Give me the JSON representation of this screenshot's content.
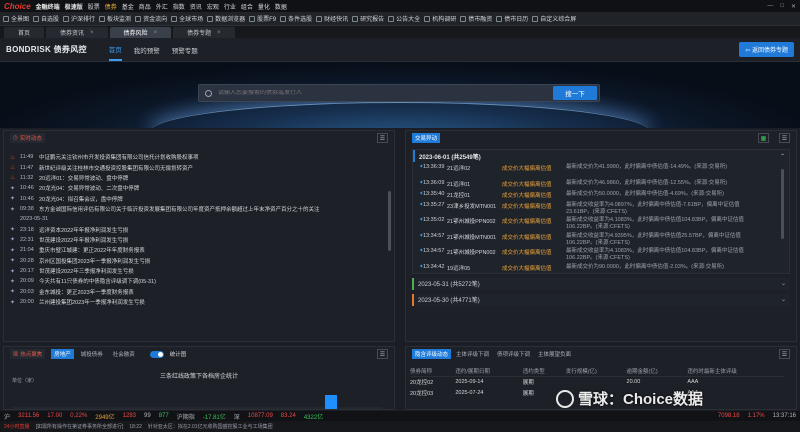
{
  "titlebar": {
    "brand": "Choice",
    "product": "金融终端",
    "terminal": "极速版",
    "menus": [
      "股票",
      "债券",
      "基金",
      "商品",
      "外汇",
      "指数",
      "资讯",
      "宏观",
      "行业",
      "组合",
      "量化",
      "数据"
    ],
    "hot_index": 1
  },
  "toolbar": [
    "全景图",
    "自选股",
    "沪深排行",
    "板块监测",
    "资金流向",
    "全球市场",
    "数据浏览器",
    "股票F9",
    "条件选股",
    "财经快讯",
    "研究报告",
    "公告大全",
    "机构调研",
    "债市融资",
    "债市日历",
    "自定义综合屏"
  ],
  "window_tabs": [
    {
      "label": "首页",
      "active": false
    },
    {
      "label": "债券资讯",
      "active": false
    },
    {
      "label": "债券风险",
      "active": true
    },
    {
      "label": "债券专题",
      "active": false
    }
  ],
  "app": {
    "brand": "BONDRISK 债券风控",
    "nav": [
      {
        "label": "首页",
        "active": true
      },
      {
        "label": "我的预警",
        "active": false
      },
      {
        "label": "预警专题",
        "active": false
      }
    ],
    "back_label": "返回债券专题"
  },
  "search": {
    "placeholder": "请输入您要搜索的债券或发行人",
    "button": "搜一下"
  },
  "realtime": {
    "title": "实时动态",
    "items_top": [
      {
        "time": "11:49",
        "hot": true,
        "text": "中证鹏元关注钦州市开发投资集团有限公司信托计划收购股权事项"
      },
      {
        "time": "11:47",
        "hot": true,
        "text": "新世纪评级关注桂林市交通投资控股集团有限公司无偿划转资产"
      },
      {
        "time": "11:32",
        "hot": true,
        "text": "20远洋01：交易异常波动、盘中停牌"
      },
      {
        "time": "10:46",
        "hot": false,
        "text": "20龙光04：交易异常波动、二次盘中停牌"
      },
      {
        "time": "10:46",
        "hot": false,
        "text": "20龙光04：拟召集会议，盘中停牌"
      },
      {
        "time": "09:38",
        "hot": false,
        "text": "东方金诚国际信用评估有限公司关于临沂投资发展集团有限公司年度资产抵押余额超过上年末净资产百分之十的关注"
      }
    ],
    "date_sep": "2023-05-31",
    "items_bottom": [
      {
        "time": "23:18",
        "text": "远洋资本2022年年报净利润发生亏损"
      },
      {
        "time": "22:31",
        "text": "世茂建设2022年年报净利润发生亏损"
      },
      {
        "time": "21:04",
        "text": "重庆市璧江城建：更正2022年年度财务报表"
      },
      {
        "time": "20:28",
        "text": "京州区国投集团2023年一季报净利润发生亏损"
      },
      {
        "time": "20:17",
        "text": "世茂建设2022年三季报净利润发生亏损"
      },
      {
        "time": "20:09",
        "text": "今天共有11只债券的中债隐含评级调下调(05-31)"
      },
      {
        "time": "20:03",
        "text": "金东城投：更正2023年一季度财务报表"
      },
      {
        "time": "20:00",
        "text": "兰州建投集团2023年一季报净利润发生亏损"
      }
    ]
  },
  "trades": {
    "title": "交易异动",
    "day": "2023-06-01 (共2549笔)",
    "rows": [
      {
        "time": "13:36:39",
        "code": "21远洋02",
        "type": "成交价大幅偏离估值",
        "desc": "最新成交价为41.9990，此时偏离中债估值-14.49%。(来源:交易所)"
      },
      {
        "time": "13:36:09",
        "code": "21远洋01",
        "type": "成交价大幅偏离估值",
        "desc": "最新成交价为46.9860，此时偏离中债估值-12.55%。(来源:交易所)"
      },
      {
        "time": "13:35:40",
        "code": "21龙控01",
        "type": "成交价大幅偏离估值",
        "desc": "最新成交价为50.0000，此时偏离中债估值-4.69%。(来源:交易所)"
      },
      {
        "time": "13:35:27",
        "code": "23津乡投发MTN001",
        "type": "成交价大幅偏离估值",
        "desc": "最新成交收益率为4.0897%，此时偏离中债估值-7.61BP，偏离中证估值23.61BP。(来源:CFETS)"
      },
      {
        "time": "13:35:02",
        "code": "21鄂州城投PPN002",
        "type": "成交价大幅偏离估值",
        "desc": "最新成交收益率为4.1083%，此时偏离中债估值104.83BP，偏离中证估值106.22BP。(来源:CFETS)"
      },
      {
        "time": "13:34:57",
        "code": "21鄂州城投MTN001",
        "type": "成交价大幅偏离估值",
        "desc": "最新成交收益率为4.9395%，此时偏离中债估值25.57BP，偏离中证估值106.22BP。(来源:CFETS)"
      },
      {
        "time": "13:34:57",
        "code": "21鄂州城投PPN002",
        "type": "成交价大幅偏离估值",
        "desc": "最新成交收益率为4.1083%，此时偏离中债估值104.83BP，偏离中证估值106.22BP。(来源:CFETS)"
      },
      {
        "time": "13:34:42",
        "code": "19远洋05",
        "type": "成交价大幅偏离估值",
        "desc": "最新成交价为90.0000，此时偏离中债估值-2.03%。(来源:交易所)"
      }
    ],
    "collapsed": [
      "2023-05-31 (共5272笔)",
      "2023-05-30 (共4771笔)"
    ]
  },
  "hotspot": {
    "title": "热点聚焦",
    "tabs": [
      "房地产",
      "城投债券",
      "社会融资"
    ],
    "active_tab": 0,
    "toggle_label": "统计图",
    "chart_title": "三条红线政策下各档房企统计",
    "ylabel": "单位（家）"
  },
  "chart_data": {
    "type": "bar",
    "title": "三条红线政策下各档房企统计",
    "ylabel": "单位（家）",
    "categories": [],
    "values": []
  },
  "bonds": {
    "tabs": [
      "隐含评级动态",
      "主体评级下调",
      "债项评级下调",
      "主体展望负面"
    ],
    "active_tab": 0,
    "columns": [
      "债券简称",
      "违约/展期日期",
      "违约类型",
      "发行规模(亿)",
      "逾期金额(亿)",
      "违约时最新主体评级"
    ],
    "rows": [
      [
        "20龙控02",
        "2025-09-14",
        "展期",
        "",
        "20.00",
        "AAA"
      ],
      [
        "20龙控03",
        "2025-07-24",
        "展期",
        "",
        "",
        "AAA"
      ]
    ]
  },
  "ticker": [
    {
      "label": "沪",
      "value": "3211.56",
      "chg": "17.00",
      "pct": "0.22%",
      "vol": "2949亿",
      "up": "1283",
      "flat": "99",
      "down": "877",
      "dir": "up"
    },
    {
      "label": "沪期指",
      "value": "-17.81亿",
      "dir": "down"
    },
    {
      "label": "深",
      "value": "10877.09",
      "chg": "83.24",
      "dir": "up"
    },
    {
      "label": "",
      "value": "4322亿",
      "dir": "green"
    }
  ],
  "ticker_right": {
    "value": "7098.18",
    "pct": "1.17%",
    "clock": "13:37:16"
  },
  "newsbar": {
    "label": "24小时直播",
    "text": "[如需所有操作在第证券事务所全部进行]",
    "time": "18:22",
    "text2": "针对亚太区：拟在2.01亿元收购国盛控股工业与工场集团"
  }
}
